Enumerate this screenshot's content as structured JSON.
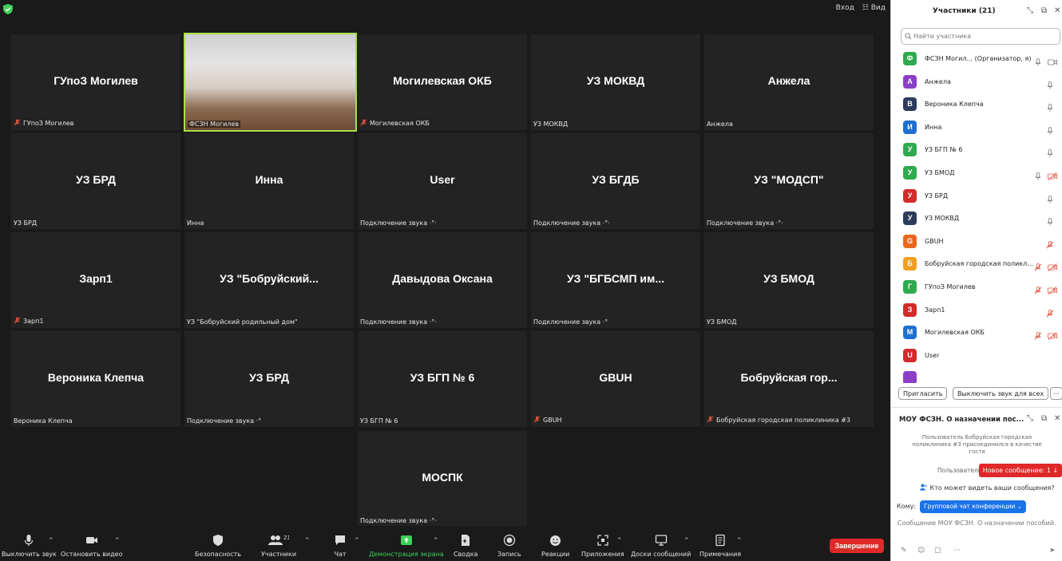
{
  "topbar": {
    "login": "Вход",
    "view": "Вид",
    "accent_green": "#3fd05a"
  },
  "tiles": [
    {
      "name": "ГУпоЗ Могилев",
      "label": "ГУпоЗ Могилев",
      "muted": true
    },
    {
      "name": "",
      "label": "ФСЗН Могилев",
      "muted": false,
      "active": true
    },
    {
      "name": "Могилевская ОКБ",
      "label": "Могилевская ОКБ",
      "muted": true
    },
    {
      "name": "УЗ МОКВД",
      "label": "УЗ МОКВД",
      "muted": false
    },
    {
      "name": "Анжела",
      "label": "Анжела",
      "muted": false
    },
    {
      "name": "УЗ БРД",
      "label": "УЗ БРД",
      "muted": false
    },
    {
      "name": "Инна",
      "label": "Инна",
      "muted": false
    },
    {
      "name": "User",
      "label": "Подключение звука ·°·",
      "muted": false
    },
    {
      "name": "УЗ БГДБ",
      "label": "Подключение звука ·°·",
      "muted": false
    },
    {
      "name": "УЗ \"МОДСП\"",
      "label": "Подключение звука ·°·",
      "muted": false
    },
    {
      "name": "Зарп1",
      "label": "Зарп1",
      "muted": true
    },
    {
      "name": "УЗ  \"Бобруйский...",
      "label": "УЗ \"Бобруйский родильный дом\"",
      "muted": false
    },
    {
      "name": "Давыдова Оксана",
      "label": "Подключение звука ·°·",
      "muted": false
    },
    {
      "name": "УЗ  \"БГБСМП им...",
      "label": "Подключение звука ·°",
      "muted": false
    },
    {
      "name": "УЗ БМОД",
      "label": "УЗ БМОД",
      "muted": false
    },
    {
      "name": "Вероника Клепча",
      "label": "Вероника Клепча",
      "muted": false
    },
    {
      "name": "УЗ БРД",
      "label": "Подключение звука ·°",
      "muted": false
    },
    {
      "name": "УЗ БГП № 6",
      "label": "УЗ БГП № 6",
      "muted": false
    },
    {
      "name": "GBUH",
      "label": "GBUH",
      "muted": true
    },
    {
      "name": "Бобруйская  гор...",
      "label": "Бобруйская городская поликлиника #3",
      "muted": true
    },
    {
      "name": "МОСПК",
      "label": "Подключение звука ·°·",
      "muted": false
    }
  ],
  "toolbar": {
    "mute": "Выключить звук",
    "video": "Остановить видео",
    "security": "Безопасность",
    "participants": "Участники",
    "participants_count": "21",
    "chat": "Чат",
    "share": "Демонстрация экрана",
    "summary": "Сводка",
    "record": "Запись",
    "reactions": "Реакции",
    "apps": "Приложения",
    "whiteboards": "Доски сообщений",
    "notes": "Примечания",
    "end": "Завершение",
    "end_color": "#e02828"
  },
  "panel": {
    "title": "Участники (21)",
    "search_placeholder": "Найти участника",
    "participants": [
      {
        "initial": "Ф",
        "color": "#2eaa4f",
        "name": "ФСЗН Могил...  (Организатор, я)",
        "mic": "on",
        "video": "on"
      },
      {
        "initial": "А",
        "color": "#8b3fc7",
        "name": "Анжела",
        "mic": "on",
        "video": ""
      },
      {
        "initial": "В",
        "color": "#2c3b5a",
        "name": "Вероника Клепча",
        "mic": "on",
        "video": ""
      },
      {
        "initial": "И",
        "color": "#1f6fd1",
        "name": "Инна",
        "mic": "on",
        "video": ""
      },
      {
        "initial": "У",
        "color": "#2eaa4f",
        "name": "УЗ БГП № 6",
        "mic": "on",
        "video": ""
      },
      {
        "initial": "У",
        "color": "#2eaa4f",
        "name": "УЗ БМОД",
        "mic": "on",
        "video": "off"
      },
      {
        "initial": "У",
        "color": "#d22b2b",
        "name": "УЗ БРД",
        "mic": "on",
        "video": ""
      },
      {
        "initial": "У",
        "color": "#2c3b5a",
        "name": "УЗ МОКВД",
        "mic": "on",
        "video": ""
      },
      {
        "initial": "G",
        "color": "#e8671e",
        "name": "GBUH",
        "mic": "off",
        "video": ""
      },
      {
        "initial": "Б",
        "color": "#f0a020",
        "name": "Бобруйская городская поликл...",
        "mic": "off",
        "video": "off"
      },
      {
        "initial": "Г",
        "color": "#2eaa4f",
        "name": "ГУпоЗ Могилев",
        "mic": "off",
        "video": "off"
      },
      {
        "initial": "З",
        "color": "#d22b2b",
        "name": "Зарп1",
        "mic": "off",
        "video": ""
      },
      {
        "initial": "М",
        "color": "#1f6fd1",
        "name": "Могилевская ОКБ",
        "mic": "off",
        "video": "off"
      },
      {
        "initial": "U",
        "color": "#d22b2b",
        "name": "User",
        "mic": "",
        "video": ""
      },
      {
        "initial": "",
        "color": "#8b3fc7",
        "name": "",
        "mic": "",
        "video": ""
      }
    ],
    "invite": "Пригласить",
    "mute_all": "Выключить звук для всех",
    "more": "···"
  },
  "chat": {
    "title": "МОУ ФСЗН. О назначении пос...",
    "system_message": "Пользователь Бобруйская городская поликлиника #3 присоединился в качестве гостя",
    "user_partial": "Пользователь",
    "new_message": "Новое сообщение: 1 ↓",
    "who_can_see": "Кто может видеть ваши сообщения?",
    "to_label": "Кому:",
    "to_value": "Групповой чат конференции ⌄",
    "input_placeholder": "Сообщение МОУ ФСЗН. О назначении пособий."
  }
}
